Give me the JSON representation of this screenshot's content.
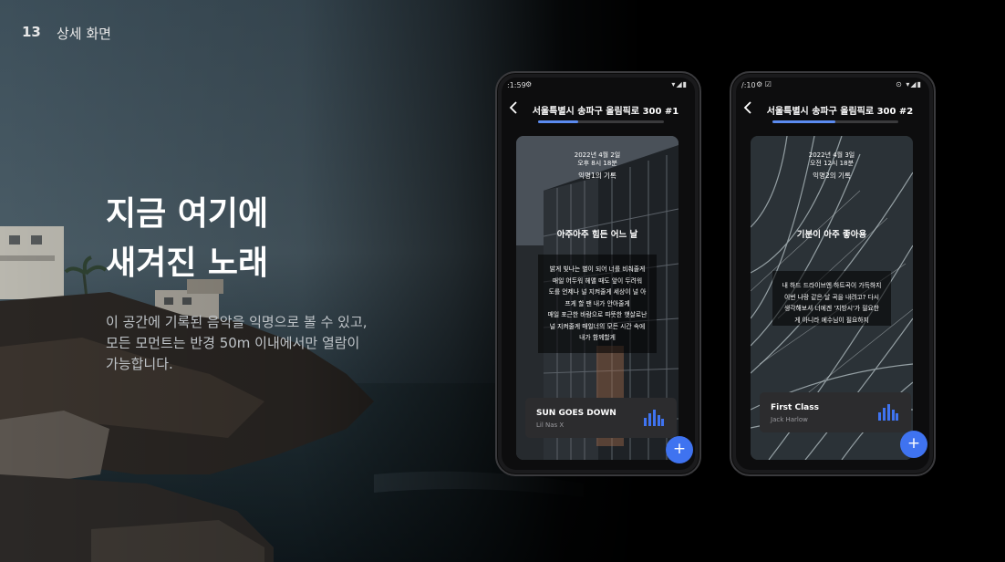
{
  "slide": {
    "number": "13",
    "section": "상세 화면",
    "headline_line1": "지금 여기에",
    "headline_line2": "새겨진 노래",
    "desc_line1": "이 공간에 기록된 음악을 익명으로 볼 수 있고,",
    "desc_line2": "모든 모먼트는 반경 50m 이내에서만 열람이",
    "desc_line3": "가능합니다."
  },
  "phones": [
    {
      "status_time": ":1:59",
      "address": "서울특별시 송파구 올림픽로 300 #1",
      "progress": 0.32,
      "date": "2022년 4월 2일",
      "time": "오후 8시 18분",
      "author": "익명1의 기록",
      "title": "아주아주 힘든 어느 날",
      "lines": [
        "밝게 빛나는 별이 되어 너를 비춰줄게",
        "매일 어두워 헤맬 때도 앞이 두려워",
        "도를 언제나 널 지켜줄게 세상이 널 아",
        "프게 할 땐 내가 안아줄게",
        "매일 포근한 바람으로 따뜻한 햇살로난",
        "널 지켜줄게 매일너의 모든 시간 속에",
        "내가 함께할게"
      ],
      "song": "SUN GOES DOWN",
      "artist": "Lil Nas X",
      "fab": "+"
    },
    {
      "status_time": "/:10",
      "address": "서울특별시 송파구 올림픽로 300 #2",
      "progress": 0.5,
      "date": "2022년 4월 3일",
      "time": "오전 12시 18분",
      "author": "익명2의 기록",
      "title": "기분이 아주 좋아용",
      "lines": [
        "내 하드 드라이브엔 하트곡이 가득하지",
        "이번 나랑 같은 날 곡을 내려고? 다시",
        "생각해보셔 너에겐 '지방시'가 필요한",
        "게 아니라 에수님이 필요하지"
      ],
      "song": "First Class",
      "artist": "Jack Harlow",
      "fab": "+"
    }
  ],
  "icons": {
    "back": "chevron-left-icon",
    "equalizer": "equalizer-icon",
    "add": "plus-icon"
  },
  "colors": {
    "accent": "#3f73f0",
    "progress": "#5b8bf0",
    "background": "#000000"
  }
}
